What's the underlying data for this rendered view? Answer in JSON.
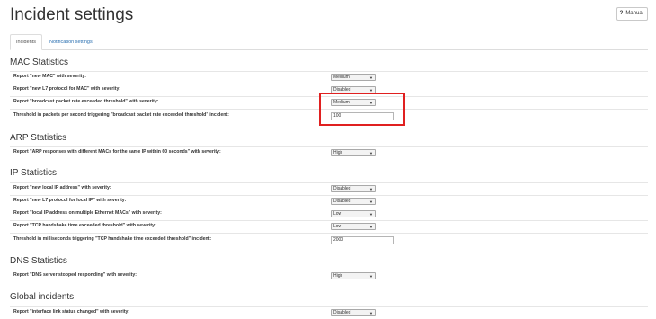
{
  "page": {
    "title": "Incident settings"
  },
  "manual_button": {
    "icon": "question-icon",
    "glyph": "?",
    "label": "Manual"
  },
  "tabs": [
    {
      "label": "Incidents",
      "active": true
    },
    {
      "label": "Notification settings",
      "active": false
    }
  ],
  "sections": {
    "mac": {
      "title": "MAC Statistics",
      "rows": [
        {
          "label": "Report \"new MAC\" with severity:",
          "value": "Medium"
        },
        {
          "label": "Report \"new L7 protocol for MAC\" with severity:",
          "value": "Disabled"
        },
        {
          "label": "Report \"broadcast packet rate exceeded threshold\" with severity:",
          "value": "Medium"
        },
        {
          "label": "Threshold in packets per second triggering \"broadcast packet rate exceeded threshold\" incident:",
          "value": "100"
        }
      ]
    },
    "arp": {
      "title": "ARP Statistics",
      "rows": [
        {
          "label": "Report \"ARP responses with different MACs for the same IP within 60 seconds\" with severity:",
          "value": "High"
        }
      ]
    },
    "ip": {
      "title": "IP Statistics",
      "rows": [
        {
          "label": "Report \"new local IP address\" with severity:",
          "value": "Disabled"
        },
        {
          "label": "Report \"new L7 protocol for local IP\" with severity:",
          "value": "Disabled"
        },
        {
          "label": "Report \"local IP address on multiple Ethernet MACs\" with severity:",
          "value": "Low"
        },
        {
          "label": "Report \"TCP handshake time exceeded threshold\" with severity:",
          "value": "Low"
        },
        {
          "label": "Threshold in milliseconds triggering \"TCP handshake time exceeded threshold\" incident:",
          "value": "2000"
        }
      ]
    },
    "dns": {
      "title": "DNS Statistics",
      "rows": [
        {
          "label": "Report \"DNS server stopped responding\" with severity:",
          "value": "High"
        }
      ]
    },
    "global": {
      "title": "Global incidents",
      "rows": [
        {
          "label": "Report \"interface link status changed\" with severity:",
          "value": "Disabled"
        }
      ]
    }
  },
  "select_arrow": "▼",
  "colors": {
    "highlight": "#e02020",
    "link": "#2a6fb0"
  }
}
